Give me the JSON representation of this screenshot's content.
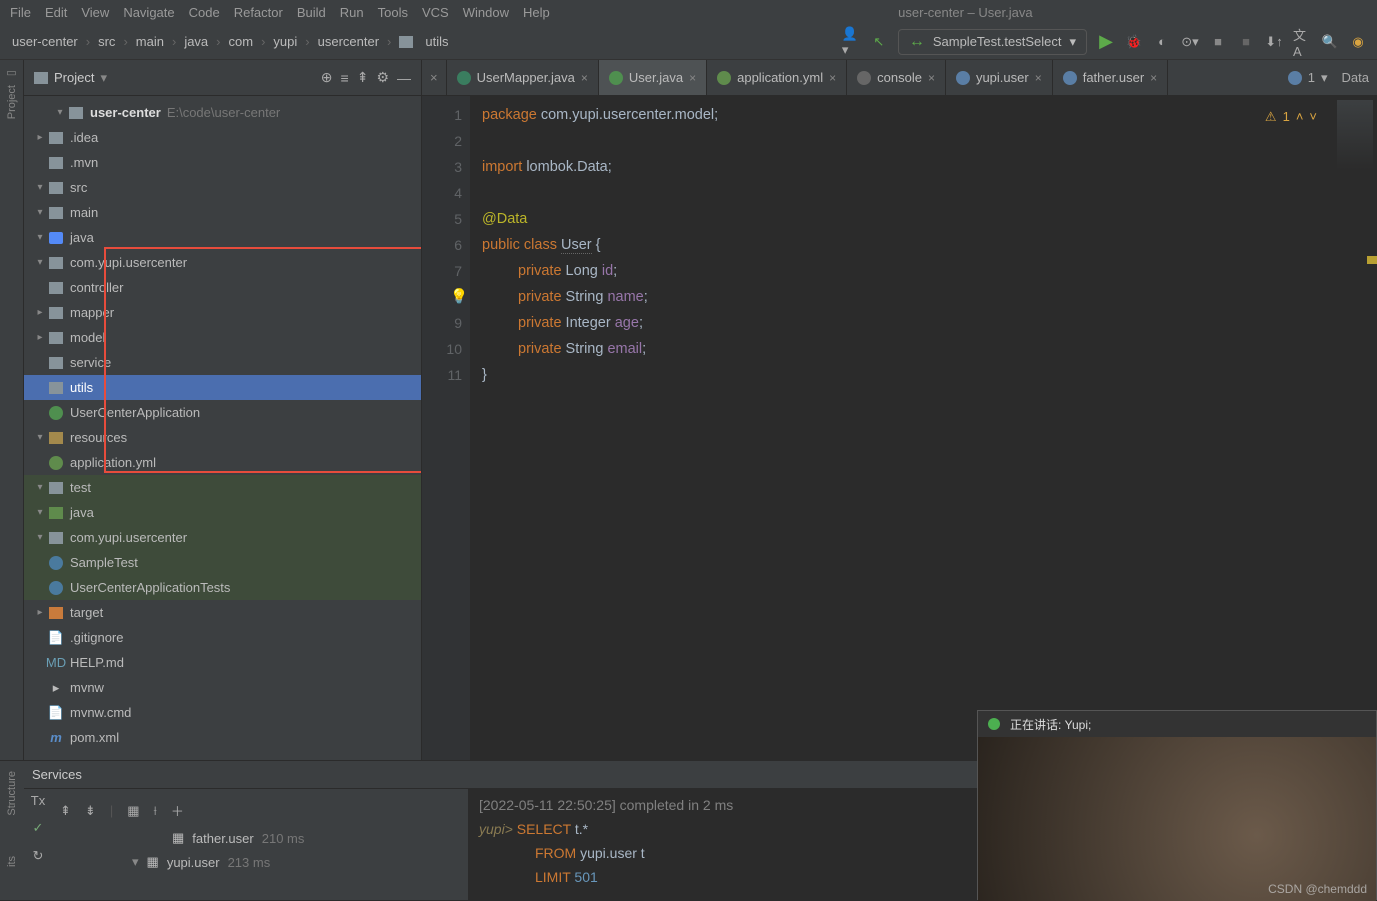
{
  "menu": {
    "items": [
      "File",
      "Edit",
      "View",
      "Navigate",
      "Code",
      "Refactor",
      "Build",
      "Run",
      "Tools",
      "VCS",
      "Window",
      "Help"
    ],
    "title": "user-center – User.java"
  },
  "breadcrumbs": [
    "user-center",
    "src",
    "main",
    "java",
    "com",
    "yupi",
    "usercenter",
    "utils"
  ],
  "run_config": {
    "label": "SampleTest.testSelect"
  },
  "project": {
    "title": "Project",
    "root": {
      "name": "user-center",
      "path": "E:\\code\\user-center"
    },
    "nodes": {
      "idea": ".idea",
      "mvn": ".mvn",
      "src": "src",
      "main": "main",
      "java": "java",
      "pkg": "com.yupi.usercenter",
      "controller": "controller",
      "mapper": "mapper",
      "model": "model",
      "service": "service",
      "utils": "utils",
      "app": "UserCenterApplication",
      "resources": "resources",
      "appyml": "application.yml",
      "test": "test",
      "java2": "java",
      "pkg2": "com.yupi.usercenter",
      "sampletest": "SampleTest",
      "apptests": "UserCenterApplicationTests",
      "target": "target",
      "gitignore": ".gitignore",
      "help": "HELP.md",
      "mvnw": "mvnw",
      "mvnwcmd": "mvnw.cmd",
      "pom": "pom.xml"
    }
  },
  "tabs": {
    "t0": "UserMapper.java",
    "t1": "User.java",
    "t2": "application.yml",
    "t3": "console",
    "t4": "yupi.user",
    "t5": "father.user",
    "more": "1",
    "right": "Data"
  },
  "code": {
    "lines": [
      "1",
      "2",
      "3",
      "4",
      "5",
      "6",
      "7",
      "8",
      "9",
      "10",
      "11"
    ],
    "l1a": "package",
    "l1b": " com.yupi.usercenter.model;",
    "l3a": "import",
    "l3b": " lombok.Data;",
    "l5": "@Data",
    "l6a": "public class ",
    "l6b": "User",
    "l6c": " {",
    "l7a": "private",
    "l7b": " Long ",
    "l7c": "id",
    "l7d": ";",
    "l8a": "private",
    "l8b": " String ",
    "l8c": "name",
    "l8d": ";",
    "l9a": "private",
    "l9b": " Integer ",
    "l9c": "age",
    "l9d": ";",
    "l10a": "private",
    "l10b": " String ",
    "l10c": "email",
    "l10d": ";",
    "l11": "}",
    "warnings": "1"
  },
  "services": {
    "title": "Services",
    "father": {
      "name": "father.user",
      "time": "210 ms"
    },
    "yupi": {
      "name": "yupi.user",
      "time": "213 ms"
    },
    "console": {
      "ts": "[2022-05-11 22:50:25] completed in 2 ms",
      "prompt": "yupi>",
      "s1": "SELECT",
      "s1b": " t.*",
      "s2": "FROM",
      "s2b": " yupi.user t",
      "s3": "LIMIT",
      "s3b": " 501"
    }
  },
  "webcam": {
    "status": "正在讲话: Yupi;"
  },
  "watermark": "CSDN @chemddd",
  "sidebars": {
    "project": "Project",
    "structure": "Structure",
    "its": "its"
  }
}
